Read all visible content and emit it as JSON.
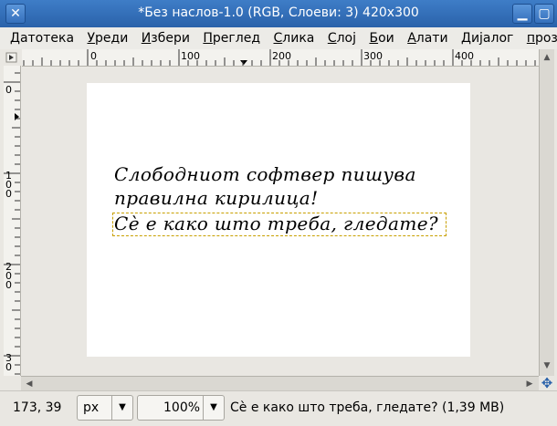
{
  "window": {
    "title": "*Без наслов-1.0 (RGB, Слоеви: 3) 420x300"
  },
  "menubar": {
    "items": [
      "Датотека",
      "Уреди",
      "Избери",
      "Преглед",
      "Слика",
      "Слој",
      "Бои",
      "Алати",
      "Дијалог",
      "прозо"
    ]
  },
  "ruler": {
    "h_labels": [
      "0",
      "100",
      "200",
      "300",
      "400"
    ],
    "v_labels": [
      "0",
      "1\n0\n0",
      "2\n0\n0",
      "3\n0"
    ]
  },
  "canvas": {
    "text_lines": [
      "Слободниот софтвер пишува",
      "правилна кирилица!",
      "Сè е како што треба, гледате?"
    ]
  },
  "statusbar": {
    "coords": "173, 39",
    "unit": "px",
    "zoom": "100%",
    "message": "Сè е како што треба, гледате? (1,39 MB)"
  }
}
